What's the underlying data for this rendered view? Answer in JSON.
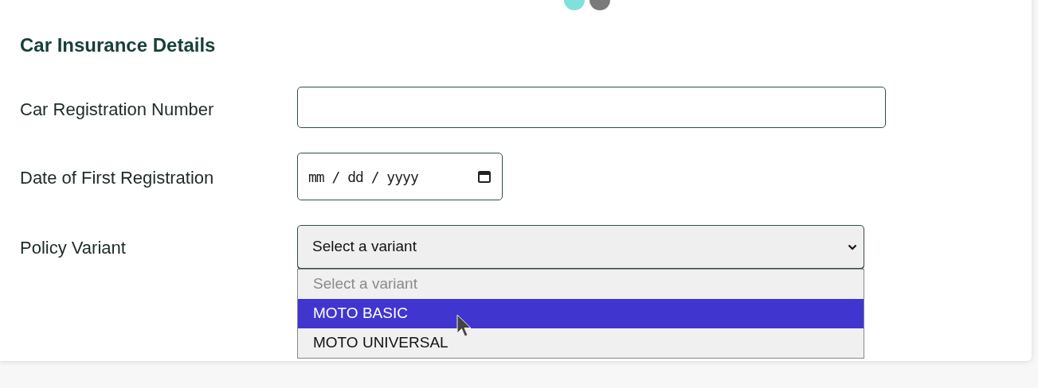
{
  "steps": [
    {
      "color": "#80e0dc"
    },
    {
      "color": "#7a7a7a"
    }
  ],
  "heading": "Car Insurance Details",
  "fields": [
    {
      "kind": "text",
      "label": "Car Registration Number"
    },
    {
      "kind": "date",
      "label": "Date of First Registration",
      "placeholder": "mm / dd / yyyy"
    },
    {
      "kind": "select",
      "label": "Policy Variant",
      "value": "Select a variant",
      "expanded": true,
      "options": [
        {
          "label": "Select a variant",
          "disabled": true,
          "highlighted": false
        },
        {
          "label": "MOTO BASIC",
          "disabled": false,
          "highlighted": true
        },
        {
          "label": "MOTO UNIVERSAL",
          "disabled": false,
          "highlighted": false
        }
      ]
    }
  ]
}
